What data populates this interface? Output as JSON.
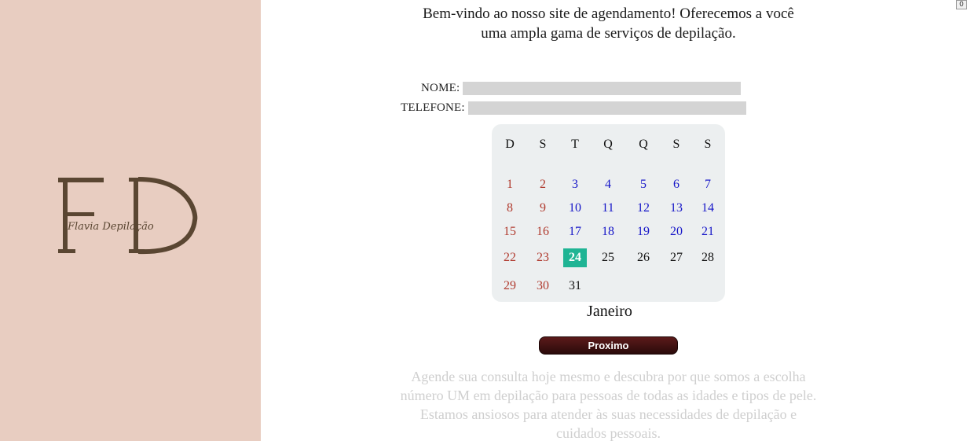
{
  "sidebar": {
    "logo": {
      "monogram": "FD",
      "script_text": "Flavia Depilação",
      "color": "#5a4632"
    },
    "background": "#e8cdc1"
  },
  "main": {
    "welcome": "Bem-vindo ao nosso site de agendamento! Oferecemos a você uma ampla gama de serviços de depilação.",
    "form": {
      "nome_label": "NOME:",
      "nome_value": "",
      "telefone_label": "TELEFONE:",
      "telefone_value": ""
    },
    "calendar": {
      "weekdays": [
        "D",
        "S",
        "T",
        "Q",
        "Q",
        "S",
        "S"
      ],
      "month": "Janeiro",
      "today": 24,
      "colors": {
        "past": "#b03a2e",
        "weekday": "#1515c8",
        "future": "#111111",
        "today_bg": "#1fb494"
      },
      "rows": [
        [
          [
            "1",
            "red"
          ],
          [
            "2",
            "red"
          ],
          [
            "3",
            "blue"
          ],
          [
            "4",
            "blue"
          ],
          [
            "5",
            "blue"
          ],
          [
            "6",
            "blue"
          ],
          [
            "7",
            "blue"
          ]
        ],
        [
          [
            "8",
            "red"
          ],
          [
            "9",
            "red"
          ],
          [
            "10",
            "blue"
          ],
          [
            "11",
            "blue"
          ],
          [
            "12",
            "blue"
          ],
          [
            "13",
            "blue"
          ],
          [
            "14",
            "blue"
          ]
        ],
        [
          [
            "15",
            "red"
          ],
          [
            "16",
            "red"
          ],
          [
            "17",
            "blue"
          ],
          [
            "18",
            "blue"
          ],
          [
            "19",
            "blue"
          ],
          [
            "20",
            "blue"
          ],
          [
            "21",
            "blue"
          ]
        ],
        [
          [
            "22",
            "red"
          ],
          [
            "23",
            "red"
          ],
          [
            "24",
            "today"
          ],
          [
            "25",
            "black"
          ],
          [
            "26",
            "black"
          ],
          [
            "27",
            "black"
          ],
          [
            "28",
            "black"
          ]
        ],
        [
          [
            "29",
            "red"
          ],
          [
            "30",
            "red"
          ],
          [
            "31",
            "black"
          ]
        ]
      ]
    },
    "next_button": "Proximo",
    "promo": "Agende sua consulta hoje mesmo e descubra por que somos a escolha número UM em depilação para pessoas de todas as idades e tipos de pele. Estamos ansiosos para atender às suas necessidades de depilação e cuidados pessoais."
  },
  "corner_glyph": "0"
}
